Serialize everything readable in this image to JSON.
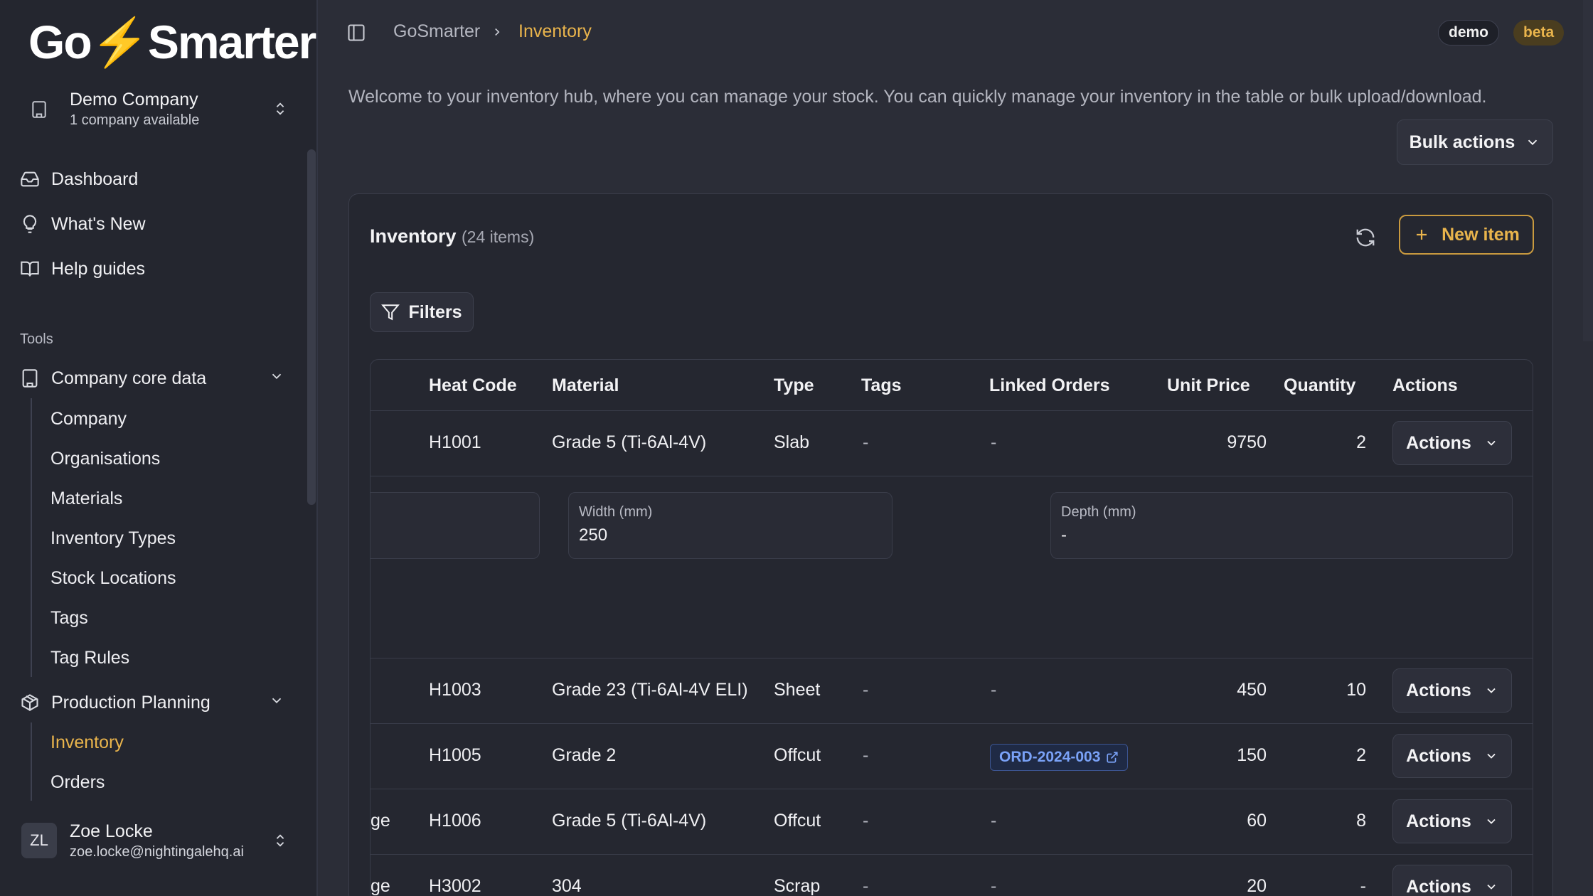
{
  "app": {
    "logo": "GoSmarter",
    "company_name": "Demo Company",
    "company_sub": "1 company available"
  },
  "sidebar": {
    "primary": [
      {
        "label": "Dashboard",
        "icon": "inbox-icon"
      },
      {
        "label": "What's New",
        "icon": "lightbulb-icon"
      },
      {
        "label": "Help guides",
        "icon": "book-icon"
      }
    ],
    "tools_label": "Tools",
    "groups": [
      {
        "label": "Company core data",
        "icon": "building-icon",
        "items": [
          "Company",
          "Organisations",
          "Materials",
          "Inventory Types",
          "Stock Locations",
          "Tags",
          "Tag Rules"
        ]
      },
      {
        "label": "Production Planning",
        "icon": "package-icon",
        "items": [
          "Inventory",
          "Orders"
        ]
      }
    ]
  },
  "user": {
    "initials": "ZL",
    "name": "Zoe Locke",
    "email": "zoe.locke@nightingalehq.ai"
  },
  "header": {
    "breadcrumb_root": "GoSmarter",
    "breadcrumb_current": "Inventory",
    "badge_demo": "demo",
    "badge_beta": "beta"
  },
  "main": {
    "welcome": "Welcome to your inventory hub, where you can manage your stock. You can quickly manage your inventory in the table or bulk upload/download.",
    "bulk_actions": "Bulk actions",
    "card_title": "Inventory",
    "card_count": "(24 items)",
    "new_item": "New item",
    "filters": "Filters"
  },
  "table": {
    "columns": [
      "Heat Code",
      "Material",
      "Type",
      "Tags",
      "Linked Orders",
      "Unit Price",
      "Quantity",
      "Actions"
    ],
    "action_label": "Actions",
    "rows": [
      {
        "lead": "",
        "heat": "H1001",
        "material": "Grade 5 (Ti-6Al-4V)",
        "type": "Slab",
        "tags": "-",
        "orders": "-",
        "price": "9750",
        "qty": "2"
      },
      {
        "lead": "",
        "heat": "H1003",
        "material": "Grade 23 (Ti-6Al-4V ELI)",
        "type": "Sheet",
        "tags": "-",
        "orders": "-",
        "price": "450",
        "qty": "10"
      },
      {
        "lead": "",
        "heat": "H1005",
        "material": "Grade 2",
        "type": "Offcut",
        "tags": "-",
        "orders": "ORD-2024-003",
        "price": "150",
        "qty": "2"
      },
      {
        "lead": "ge",
        "heat": "H1006",
        "material": "Grade 5 (Ti-6Al-4V)",
        "type": "Offcut",
        "tags": "-",
        "orders": "-",
        "price": "60",
        "qty": "8"
      },
      {
        "lead": "ge",
        "heat": "H3002",
        "material": "304",
        "type": "Scrap",
        "tags": "-",
        "orders": "-",
        "price": "20",
        "qty": "-"
      }
    ],
    "expanded": {
      "width_label": "Width (mm)",
      "width_value": "250",
      "depth_label": "Depth (mm)",
      "depth_value": "-"
    }
  },
  "colors": {
    "accent": "#e9b44c",
    "background": "#2b2d37",
    "sidebar": "#24262f",
    "link": "#7aa2f7"
  }
}
